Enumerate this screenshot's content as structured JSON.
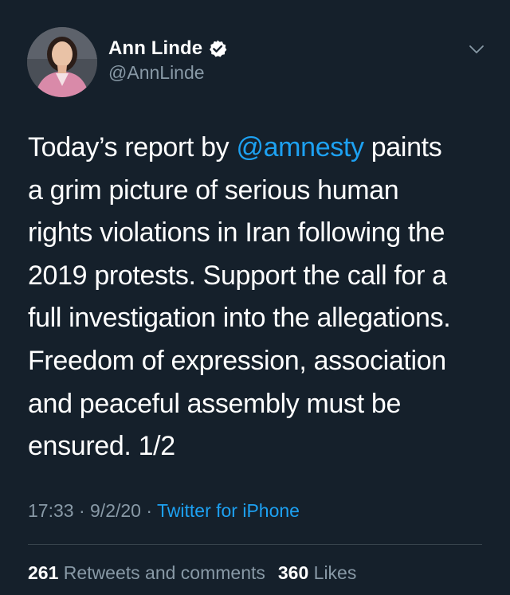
{
  "author": {
    "display_name": "Ann Linde",
    "handle": "@AnnLinde",
    "verified": true
  },
  "tweet": {
    "lines": [
      {
        "pre": "Today’s report by ",
        "mention": "@amnesty",
        "post": " paints"
      },
      {
        "text": "a grim picture of serious human"
      },
      {
        "text": "rights violations in Iran following the"
      },
      {
        "text": "2019 protests. Support the call for a"
      },
      {
        "text": "full investigation into the allegations."
      },
      {
        "text": "Freedom of expression, association"
      },
      {
        "text": "and peaceful assembly must be"
      },
      {
        "text": "ensured. 1/2"
      }
    ]
  },
  "meta": {
    "time": "17:33",
    "separator": " · ",
    "date": "9/2/20",
    "source": "Twitter for iPhone"
  },
  "stats": {
    "retweets_count": "261",
    "retweets_label": "Retweets and comments",
    "likes_count": "360",
    "likes_label": "Likes"
  },
  "colors": {
    "background": "#15202b",
    "text": "#ffffff",
    "secondary": "#8899a6",
    "accent": "#1da1f2",
    "divider": "#38444d"
  },
  "icons": {
    "verified": "verified-badge-icon",
    "menu": "chevron-down-icon"
  }
}
